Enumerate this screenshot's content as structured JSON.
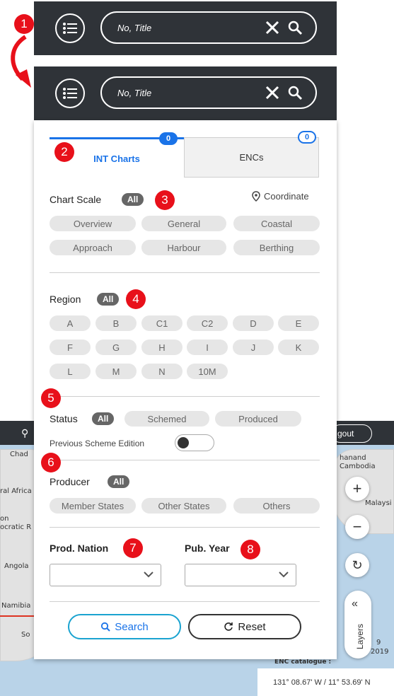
{
  "markers": [
    "1",
    "2",
    "3",
    "4",
    "5",
    "6",
    "7",
    "8"
  ],
  "search": {
    "placeholder": "No, Title"
  },
  "tabs": {
    "int": {
      "label": "INT Charts",
      "count": "0"
    },
    "enc": {
      "label": "ENCs",
      "count": "0"
    }
  },
  "chart_scale": {
    "title": "Chart Scale",
    "all": "All",
    "coordinate": "Coordinate",
    "options": [
      "Overview",
      "General",
      "Coastal",
      "Approach",
      "Harbour",
      "Berthing"
    ]
  },
  "region": {
    "title": "Region",
    "all": "All",
    "options": [
      "A",
      "B",
      "C1",
      "C2",
      "D",
      "E",
      "F",
      "G",
      "H",
      "I",
      "J",
      "K",
      "L",
      "M",
      "N",
      "10M"
    ]
  },
  "status": {
    "title": "Status",
    "all": "All",
    "options": [
      "Schemed",
      "Produced"
    ],
    "previous_label": "Previous Scheme Edition",
    "previous_on": false
  },
  "producer": {
    "title": "Producer",
    "all": "All",
    "options": [
      "Member States",
      "Other States",
      "Others"
    ]
  },
  "prod_nation": {
    "label": "Prod. Nation",
    "value": ""
  },
  "pub_year": {
    "label": "Pub. Year",
    "value": ""
  },
  "buttons": {
    "search": "Search",
    "reset": "Reset"
  },
  "map": {
    "logout": "gout",
    "labels": [
      "Chad",
      "ral Africa",
      "on",
      "ocratic R",
      "Angola",
      "Namibia",
      "So",
      "hanand",
      "Cambodia",
      "Malaysi",
      "9",
      "2019",
      "ENC catalogue :"
    ],
    "coordinates": "131° 08.67' W  /  11° 53.69' N",
    "layers": "Layers"
  },
  "colors": {
    "accent": "#1a73e8",
    "marker": "#e8101a",
    "bar": "#2f3338"
  }
}
